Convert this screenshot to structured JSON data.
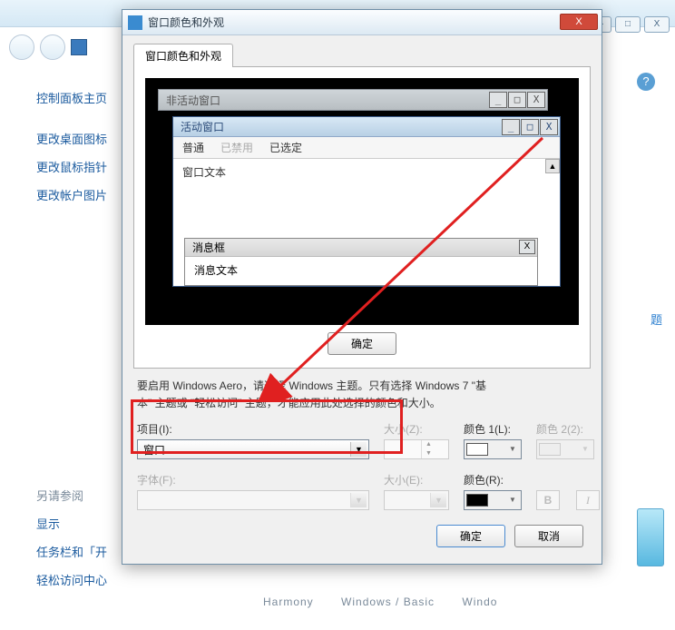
{
  "parent": {
    "help_glyph": "?"
  },
  "sidebar": {
    "home": "控制面板主页",
    "links": [
      "更改桌面图标",
      "更改鼠标指针",
      "更改帐户图片"
    ],
    "seealso_label": "另请参阅",
    "seealso": [
      "显示",
      "任务栏和「开",
      "轻松访问中心"
    ]
  },
  "themes": {
    "a": "Harmony",
    "b": "Windows / Basic",
    "c": "Windo"
  },
  "dialog": {
    "title": "窗口颜色和外观",
    "tab": "窗口颜色和外观",
    "close_glyph": "X"
  },
  "preview": {
    "inactive_title": "非活动窗口",
    "active_title": "活动窗口",
    "menu": {
      "normal": "普通",
      "disabled": "已禁用",
      "selected": "已选定"
    },
    "window_text": "窗口文本",
    "msgbox_title": "消息框",
    "msgbox_text": "消息文本",
    "ok": "确定",
    "btn_min": "_",
    "btn_max": "□",
    "btn_close": "X",
    "scroll_up": "▲"
  },
  "desc_line1": "要启用 Windows Aero，请选择 Windows 主题。只有选择 Windows 7 \"基",
  "desc_line2": "本\" 主题或 \"轻松访问\" 主题，才能应用此处选择的颜色和大小。",
  "form": {
    "item_label": "项目(I):",
    "item_value": "窗口",
    "size_label": "大小(Z):",
    "color1_label": "颜色 1(L):",
    "color2_label": "颜色 2(2):",
    "font_label": "字体(F):",
    "fontsize_label": "大小(E):",
    "fontcolor_label": "颜色(R):",
    "bold": "B",
    "italic": "I",
    "dropdown_arrow": "▼",
    "spin_up": "▲",
    "spin_dn": "▼"
  },
  "footer": {
    "ok": "确定",
    "cancel": "取消"
  },
  "right": {
    "faded": "题"
  }
}
